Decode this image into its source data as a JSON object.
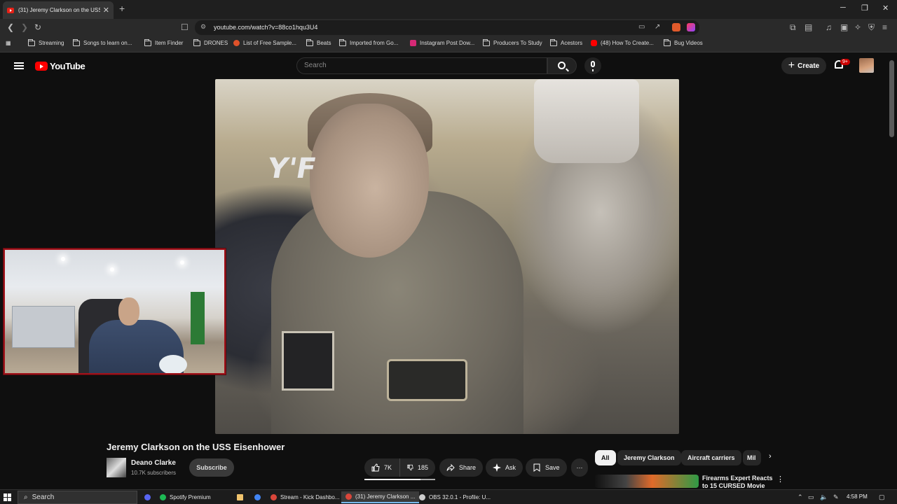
{
  "browser": {
    "tab_title": "(31) Jeremy Clarkson on the USS",
    "tab_close": "✕",
    "new_tab": "+",
    "window_controls": [
      "─",
      "❐",
      "✕"
    ],
    "url": "youtube.com/watch?v=88co1hqu3U4"
  },
  "bookmarks": [
    {
      "label": "Streaming",
      "icon": "folder-icon"
    },
    {
      "label": "Songs to learn on...",
      "icon": "folder-icon"
    },
    {
      "label": "Item Finder",
      "icon": "folder-icon"
    },
    {
      "label": "DRONES",
      "icon": "folder-icon"
    },
    {
      "label": "List of Free Sample...",
      "icon": "site-icon"
    },
    {
      "label": "Beats",
      "icon": "folder-icon"
    },
    {
      "label": "Imported from Go...",
      "icon": "folder-icon"
    },
    {
      "label": "Instagram Post Dow...",
      "icon": "site-icon"
    },
    {
      "label": "Producers To Study",
      "icon": "folder-icon"
    },
    {
      "label": "Acestors",
      "icon": "folder-icon"
    },
    {
      "label": "(48) How To Create...",
      "icon": "youtube-icon"
    },
    {
      "label": "Bug Videos",
      "icon": "folder-icon"
    }
  ],
  "youtube": {
    "logo_text": "YouTube",
    "search_placeholder": "Search",
    "create_label": "Create",
    "notification_badge": "9+"
  },
  "video": {
    "overlay_text": "Y'F",
    "title": "Jeremy Clarkson on the USS Eisenhower",
    "channel_name": "Deano Clarke",
    "subscribers": "10.7K subscribers",
    "subscribe_label": "Subscribe",
    "likes": "7K",
    "dislikes": "185",
    "like_ratio": 0.79,
    "share_label": "Share",
    "ask_label": "Ask",
    "save_label": "Save",
    "more_label": "⋯"
  },
  "chips": [
    "All",
    "Jeremy Clarkson",
    "Aircraft carriers",
    "Mil"
  ],
  "recommended": {
    "title": "Firearms Expert Reacts to 15 CURSED Movie",
    "menu": "⋮"
  },
  "taskbar": {
    "search_label": "Search",
    "items": [
      {
        "label": "",
        "color": "#5865f2"
      },
      {
        "label": "Spotify Premium",
        "color": "#1db954"
      },
      {
        "label": "",
        "color": "#f0c36d"
      },
      {
        "label": "",
        "color": "#4285f4"
      },
      {
        "label": "Stream - Kick Dashbo...",
        "color": "#d9463a"
      },
      {
        "label": "(31) Jeremy Clarkson ...",
        "color": "#d9463a"
      },
      {
        "label": "OBS 32.0.1 - Profile: U...",
        "color": "#cccccc"
      }
    ],
    "clock": "4:58 PM"
  },
  "colors": {
    "youtube_red": "#ff0000",
    "webcam_border": "#a0121a",
    "background": "#0f0f0f"
  }
}
